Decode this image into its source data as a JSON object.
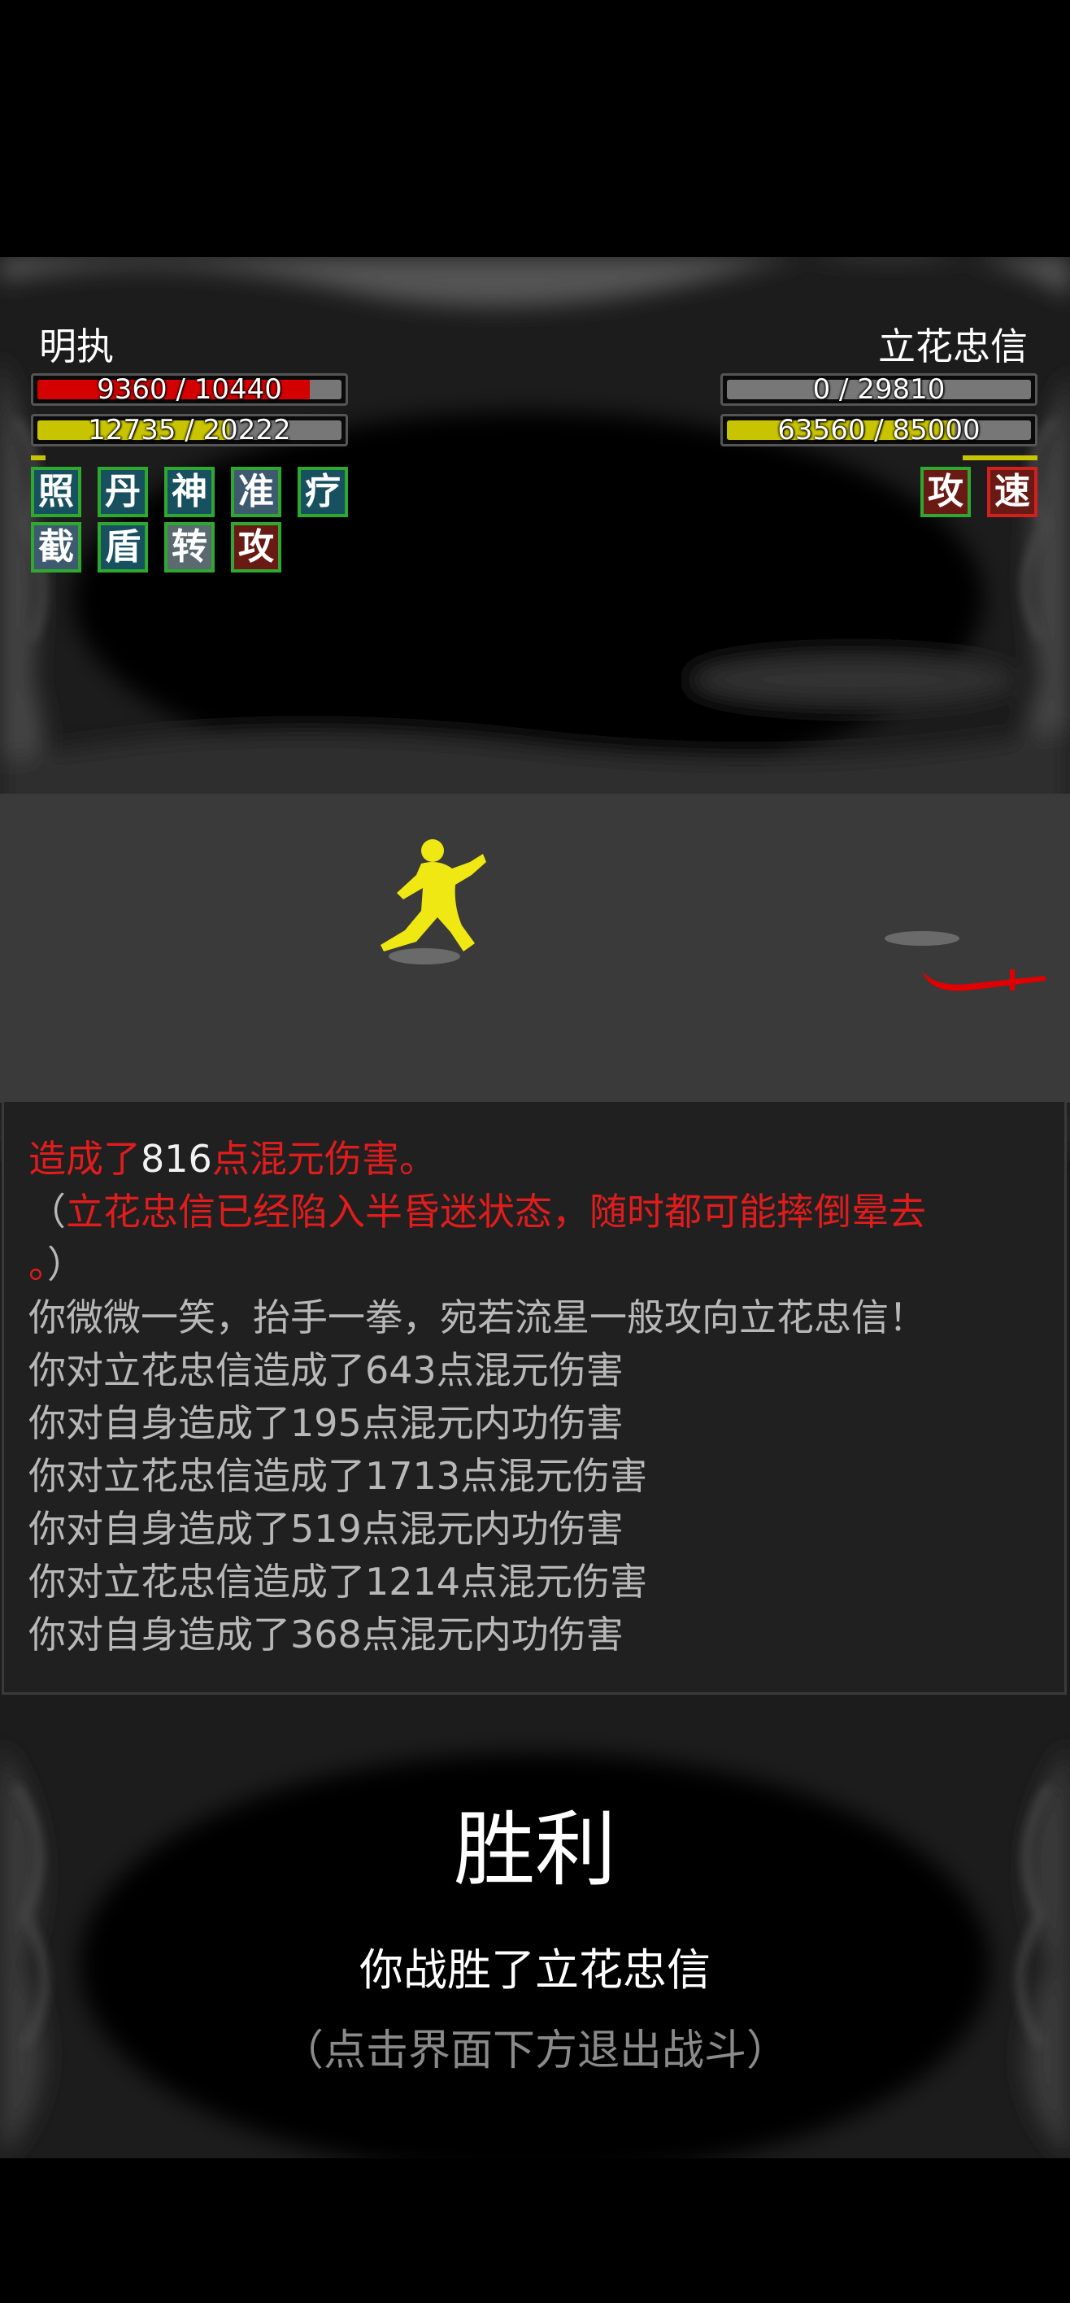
{
  "player": {
    "name": "明执",
    "hp_text": "9360 / 10440",
    "hp_ratio": 0.897,
    "mp_text": "12735 / 20222",
    "mp_ratio": 0.63,
    "buffs": [
      "照",
      "丹",
      "神",
      "准",
      "疗",
      "截",
      "盾",
      "转",
      "攻"
    ]
  },
  "enemy": {
    "name": "立花忠信",
    "hp_text": "0 / 29810",
    "hp_ratio": 0.0,
    "mp_text": "63560 / 85000",
    "mp_ratio": 0.748,
    "buffs": [
      "攻",
      "速"
    ]
  },
  "log": {
    "line1_prefix": "造成了",
    "line1_number": "816",
    "line1_suffix": "点混元伤害。",
    "line2_open": "（",
    "line2_text": "立花忠信已经陷入半昏迷状态，随时都可能摔倒晕去",
    "line3_text": "。",
    "line3_close": "）",
    "lines": [
      "你微微一笑，抬手一拳，宛若流星一般攻向立花忠信！",
      "你对立花忠信造成了643点混元伤害",
      "你对自身造成了195点混元内功伤害",
      "你对立花忠信造成了1713点混元伤害",
      "你对自身造成了519点混元内功伤害",
      "你对立花忠信造成了1214点混元伤害",
      "你对自身造成了368点混元内功伤害"
    ]
  },
  "result": {
    "title": "胜利",
    "subtitle": "你战胜了立花忠信",
    "hint": "（点击界面下方退出战斗）"
  },
  "colors": {
    "hp": "#d40000",
    "mp": "#c9c400",
    "player_figure": "#f0e812",
    "enemy_weapon": "#e00000",
    "log_red": "#e01c1c"
  }
}
